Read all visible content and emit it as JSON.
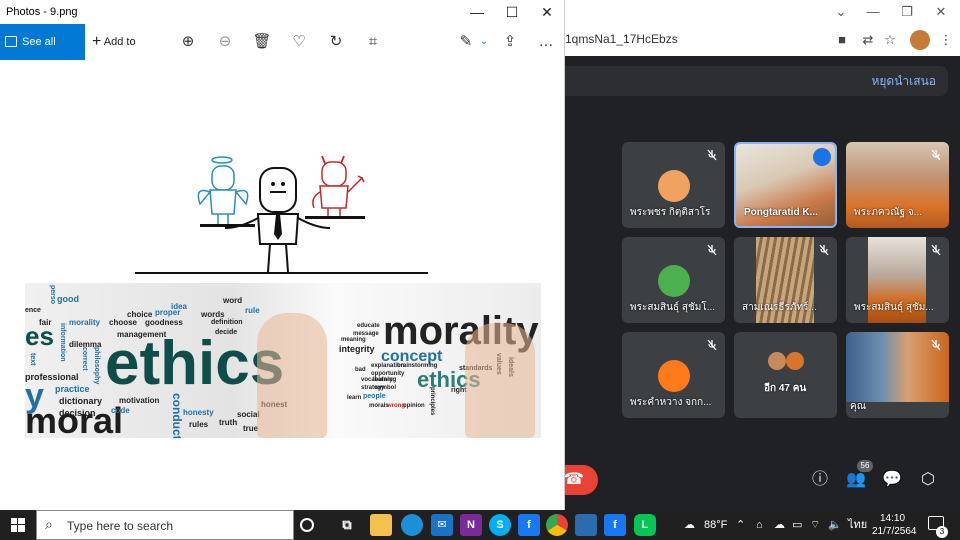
{
  "chrome": {
    "url_fragment": "1qmsNa1_17HcEbzs",
    "present_stop_label": "หยุดนำเสนอ"
  },
  "meet": {
    "tiles": [
      {
        "name": "พระพชร กิตฺติสาโร",
        "type": "avatar",
        "color": "#f0a35e"
      },
      {
        "name": "Pongtaratid K...",
        "type": "video",
        "speaking": true
      },
      {
        "name": "พระภควณัฐ จ...",
        "type": "video"
      },
      {
        "name": "พระสมสินธุ์ สุชัมโ...",
        "type": "avatar",
        "color": "#4caf50"
      },
      {
        "name": "สามเณรธีรภัทร์...",
        "type": "video"
      },
      {
        "name": "พระสมสินธุ์ สุชัม...",
        "type": "video"
      },
      {
        "name": "พระคำหวาง จกก...",
        "type": "avatar",
        "color": "#ff7a1a"
      },
      {
        "name": "อีก 47 คน",
        "type": "more"
      },
      {
        "name": "คุณ",
        "type": "video"
      }
    ],
    "people_count": "56"
  },
  "photos": {
    "title": "Photos - 9.png",
    "see_all_label": "See all photos",
    "add_to_label": "Add to",
    "wordcloud": {
      "big": [
        "ethics",
        "morality",
        "moral",
        "concept",
        "ethics"
      ],
      "small": [
        "good",
        "choice",
        "proper",
        "idea",
        "words",
        "word",
        "rule",
        "fair",
        "morality",
        "choose",
        "goodness",
        "definition",
        "decide",
        "dilemma",
        "management",
        "professional",
        "practice",
        "dictionary",
        "motivation",
        "decision",
        "code",
        "honesty",
        "social",
        "rules",
        "truth",
        "true",
        "honest",
        "text",
        "correct",
        "philosophy",
        "information",
        "integrity",
        "educate",
        "message",
        "meaning",
        "explanation",
        "vocabulary",
        "strategy",
        "opportunity",
        "learn",
        "people",
        "standards",
        "values",
        "ideals",
        "morals",
        "wrong",
        "opinion",
        "principles",
        "brainstorming",
        "right",
        "learning",
        "symbol",
        "conduct",
        "bad",
        "es",
        "y",
        "perso",
        "ence"
      ]
    }
  },
  "taskbar": {
    "search_placeholder": "Type here to search",
    "weather": "88°F",
    "language": "ไทย",
    "time": "14:10",
    "date": "21/7/2564",
    "notification_count": "3"
  }
}
